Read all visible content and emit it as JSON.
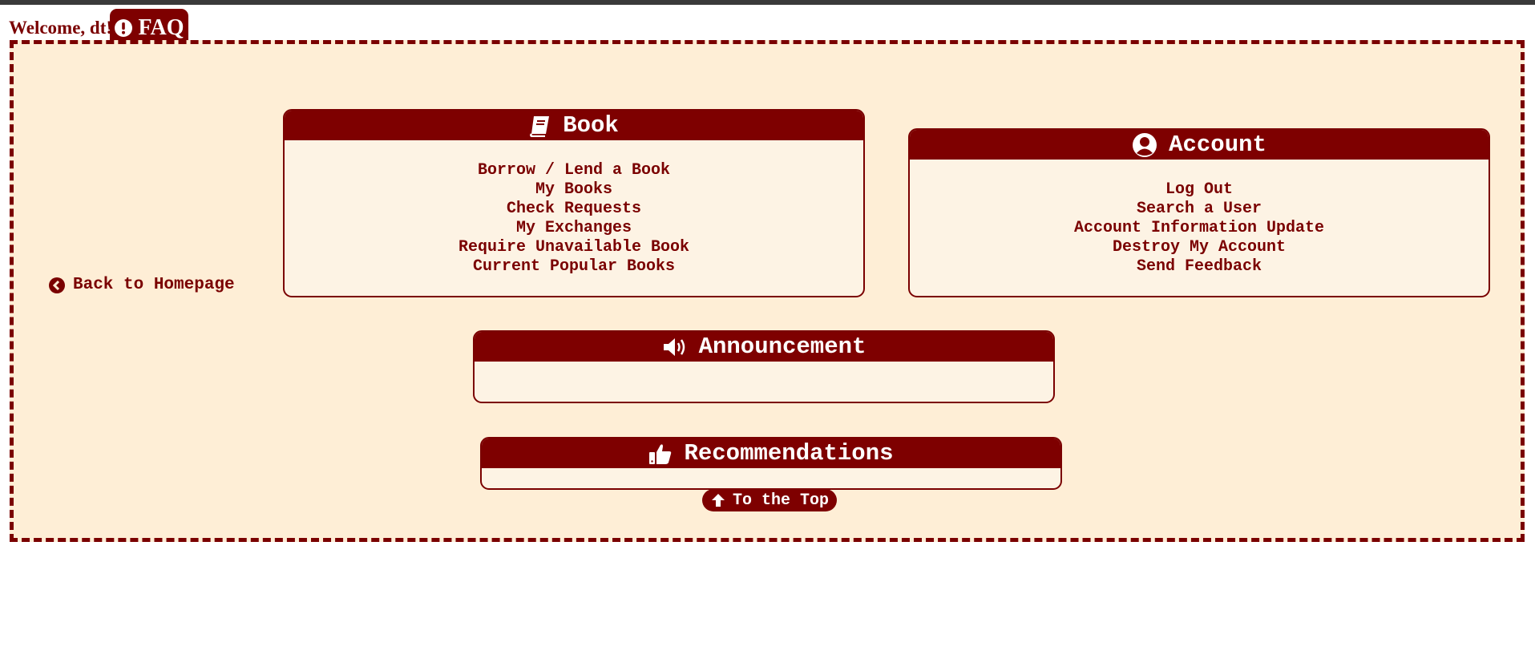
{
  "header": {
    "welcome_text": "Welcome, dt!",
    "faq_label": "FAQ",
    "faq_icon": "exclamation-circle-icon"
  },
  "navigation": {
    "back_label": "Back to Homepage",
    "back_icon": "chevron-circle-left-icon",
    "to_top_label": "To the Top",
    "to_top_icon": "arrow-up-icon"
  },
  "cards": {
    "book": {
      "title": "Book",
      "icon": "book-icon",
      "links": [
        "Borrow / Lend a Book",
        "My Books",
        "Check Requests",
        "My Exchanges",
        "Require Unavailable Book",
        "Current Popular Books"
      ]
    },
    "account": {
      "title": "Account",
      "icon": "user-circle-icon",
      "links": [
        "Log Out",
        "Search a User",
        "Account Information Update",
        "Destroy My Account",
        "Send Feedback"
      ]
    },
    "announcement": {
      "title": "Announcement",
      "icon": "megaphone-icon"
    },
    "recommendations": {
      "title": "Recommendations",
      "icon": "thumbs-up-icon"
    }
  },
  "colors": {
    "accent": "#7e0000",
    "frame_background": "#feeed6",
    "card_background": "#fdf3e4"
  }
}
